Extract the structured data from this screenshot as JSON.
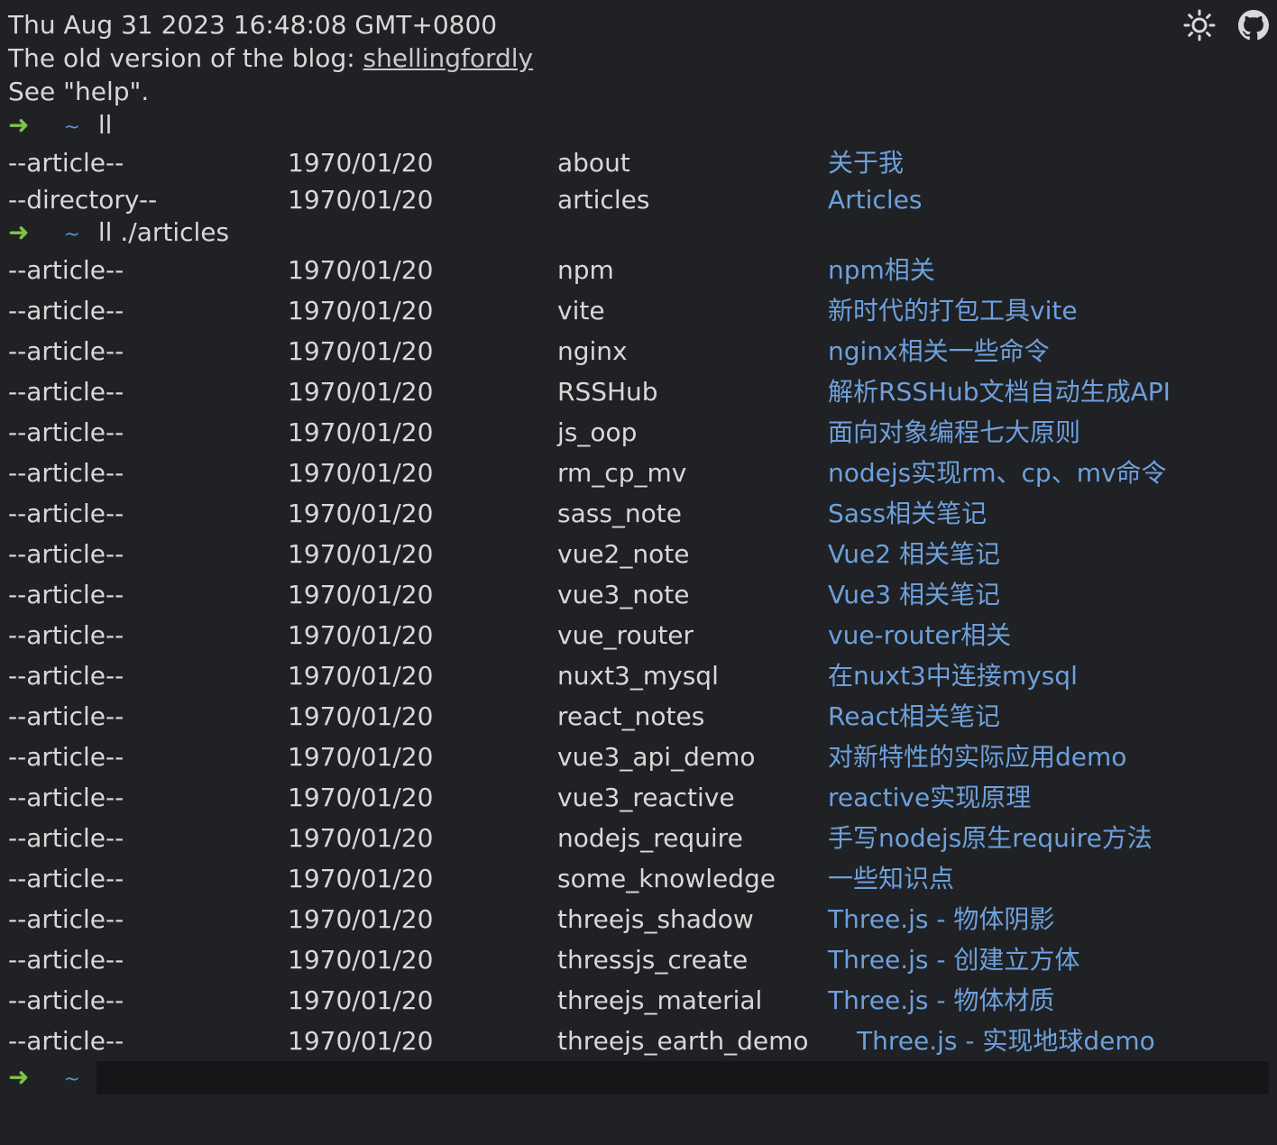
{
  "header": {
    "datetime": "Thu Aug 31 2023 16:48:08 GMT+0800",
    "old_version_prefix": "The old version of the blog: ",
    "old_version_link": "shellingfordly",
    "help_hint": "See \"help\"."
  },
  "toolbar": {
    "theme_icon": "sun-icon",
    "github_icon": "github-icon"
  },
  "prompt": {
    "arrow": "➜",
    "tilde": "~"
  },
  "commands": {
    "first": "ll",
    "second": "ll ./articles"
  },
  "root_listing": [
    {
      "type": "--article--",
      "date": "1970/01/20",
      "name": "about",
      "title": "关于我"
    },
    {
      "type": "--directory--",
      "date": "1970/01/20",
      "name": "articles",
      "title": "Articles"
    }
  ],
  "articles_listing": [
    {
      "type": "--article--",
      "date": "1970/01/20",
      "name": "npm",
      "title": "npm相关"
    },
    {
      "type": "--article--",
      "date": "1970/01/20",
      "name": "vite",
      "title": "新时代的打包工具vite"
    },
    {
      "type": "--article--",
      "date": "1970/01/20",
      "name": "nginx",
      "title": "nginx相关一些命令"
    },
    {
      "type": "--article--",
      "date": "1970/01/20",
      "name": "RSSHub",
      "title": "解析RSSHub文档自动生成API"
    },
    {
      "type": "--article--",
      "date": "1970/01/20",
      "name": "js_oop",
      "title": "面向对象编程七大原则"
    },
    {
      "type": "--article--",
      "date": "1970/01/20",
      "name": "rm_cp_mv",
      "title": "nodejs实现rm、cp、mv命令"
    },
    {
      "type": "--article--",
      "date": "1970/01/20",
      "name": "sass_note",
      "title": "Sass相关笔记"
    },
    {
      "type": "--article--",
      "date": "1970/01/20",
      "name": "vue2_note",
      "title": "Vue2 相关笔记"
    },
    {
      "type": "--article--",
      "date": "1970/01/20",
      "name": "vue3_note",
      "title": "Vue3 相关笔记"
    },
    {
      "type": "--article--",
      "date": "1970/01/20",
      "name": "vue_router",
      "title": "vue-router相关"
    },
    {
      "type": "--article--",
      "date": "1970/01/20",
      "name": "nuxt3_mysql",
      "title": "在nuxt3中连接mysql"
    },
    {
      "type": "--article--",
      "date": "1970/01/20",
      "name": "react_notes",
      "title": "React相关笔记"
    },
    {
      "type": "--article--",
      "date": "1970/01/20",
      "name": "vue3_api_demo",
      "title": "对新特性的实际应用demo"
    },
    {
      "type": "--article--",
      "date": "1970/01/20",
      "name": "vue3_reactive",
      "title": "reactive实现原理"
    },
    {
      "type": "--article--",
      "date": "1970/01/20",
      "name": "nodejs_require",
      "title": "手写nodejs原生require方法"
    },
    {
      "type": "--article--",
      "date": "1970/01/20",
      "name": "some_knowledge",
      "title": "一些知识点"
    },
    {
      "type": "--article--",
      "date": "1970/01/20",
      "name": "threejs_shadow",
      "title": "Three.js - 物体阴影"
    },
    {
      "type": "--article--",
      "date": "1970/01/20",
      "name": "thressjs_create",
      "title": "Three.js - 创建立方体"
    },
    {
      "type": "--article--",
      "date": "1970/01/20",
      "name": "threejs_material",
      "title": "Three.js - 物体材质"
    },
    {
      "type": "--article--",
      "date": "1970/01/20",
      "name": "threejs_earth_demo",
      "title": "Three.js - 实现地球demo"
    }
  ],
  "input": {
    "value": ""
  }
}
